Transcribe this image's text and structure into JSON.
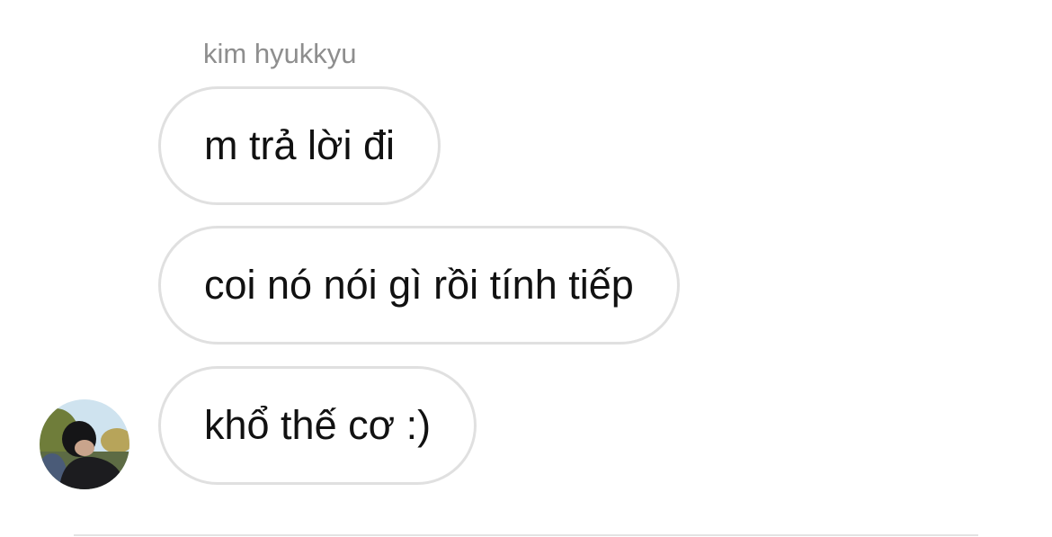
{
  "conversation": {
    "sender_name": "kim hyukkyu",
    "messages": [
      {
        "text": "m trả lời đi"
      },
      {
        "text": "coi nó nói gì rồi tính tiếp"
      },
      {
        "text": "khổ thế cơ :)"
      }
    ]
  },
  "avatar": {
    "icon": "profile-photo",
    "colors": {
      "sky": "#cfe3ef",
      "foliage": "#6f7d3a",
      "foliage_light": "#b7a45a",
      "clothing": "#1c1c1f",
      "hair": "#151517",
      "skin": "#c9a48c"
    }
  },
  "theme": {
    "bubble_border": "#e0e0e0",
    "sender_color": "#8e8e8e",
    "text_color": "#111111"
  }
}
